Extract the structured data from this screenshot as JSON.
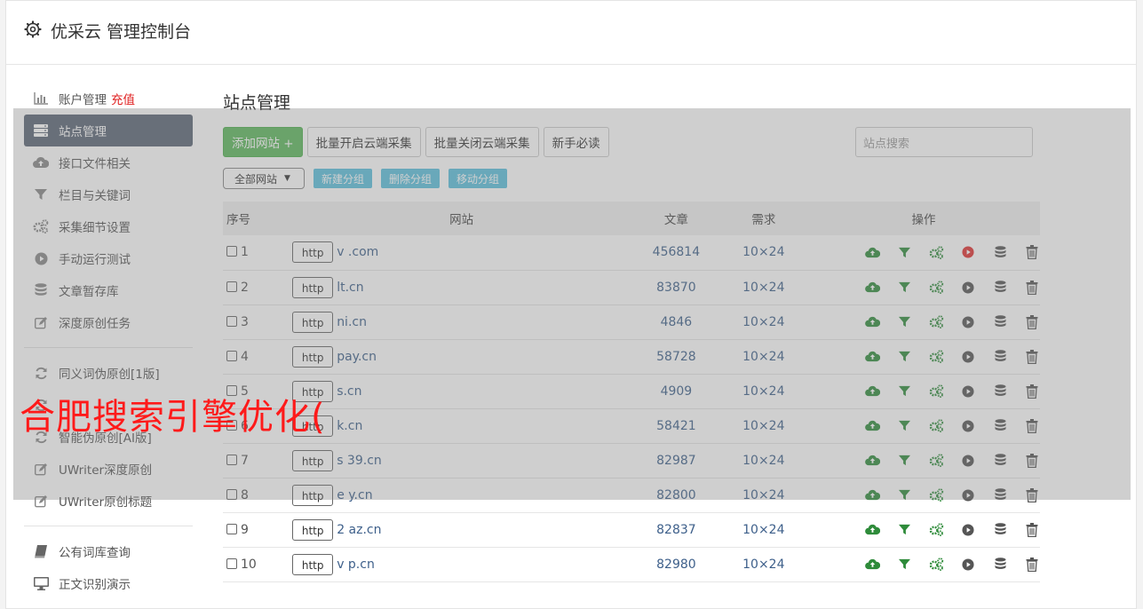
{
  "header": {
    "title": "优采云 管理控制台"
  },
  "sidebar": {
    "group1": [
      {
        "label": "账户管理",
        "extra": "充值",
        "icon": "bar-chart-icon"
      },
      {
        "label": "站点管理",
        "icon": "server-icon",
        "active": true
      },
      {
        "label": "接口文件相关",
        "icon": "cloud-upload-icon"
      },
      {
        "label": "栏目与关键词",
        "icon": "filter-icon"
      },
      {
        "label": "采集细节设置",
        "icon": "cogs-icon"
      },
      {
        "label": "手动运行测试",
        "icon": "play-circle-icon"
      },
      {
        "label": "文章暂存库",
        "icon": "database-icon"
      },
      {
        "label": "深度原创任务",
        "icon": "edit-icon"
      }
    ],
    "group2": [
      {
        "label": "同义词伪原创[1版]",
        "icon": "refresh-icon"
      },
      {
        "label": "",
        "icon": "refresh-icon"
      },
      {
        "label": "智能伪原创[AI版]",
        "icon": "refresh-icon"
      },
      {
        "label": "UWriter深度原创",
        "icon": "edit-icon"
      },
      {
        "label": "UWriter原创标题",
        "icon": "edit-icon"
      }
    ],
    "group3": [
      {
        "label": "公有词库查询",
        "icon": "book-icon"
      },
      {
        "label": "正文识别演示",
        "icon": "monitor-icon"
      }
    ]
  },
  "main": {
    "title": "站点管理",
    "toolbar": {
      "add_site": "添加网站 +",
      "batch_open": "批量开启云端采集",
      "batch_close": "批量关闭云端采集",
      "guide": "新手必读"
    },
    "search_placeholder": "站点搜索",
    "group_select": "全部网站",
    "group_buttons": {
      "new": "新建分组",
      "delete": "删除分组",
      "move": "移动分组"
    },
    "table": {
      "headers": {
        "no": "序号",
        "site": "网站",
        "articles": "文章",
        "demand": "需求",
        "ops": "操作"
      },
      "http_label": "http",
      "rows": [
        {
          "no": "1",
          "domain": "v .com",
          "articles": "456814",
          "demand": "10×24",
          "play_active": true
        },
        {
          "no": "2",
          "domain": "lt.cn",
          "articles": "83870",
          "demand": "10×24",
          "play_active": false
        },
        {
          "no": "3",
          "domain": "ni.cn",
          "articles": "4846",
          "demand": "10×24",
          "play_active": false
        },
        {
          "no": "4",
          "domain": "pay.cn",
          "articles": "58728",
          "demand": "10×24",
          "play_active": false
        },
        {
          "no": "5",
          "domain": "s.cn",
          "articles": "4909",
          "demand": "10×24",
          "play_active": false
        },
        {
          "no": "6",
          "domain": "k.cn",
          "articles": "58421",
          "demand": "10×24",
          "play_active": false
        },
        {
          "no": "7",
          "domain": "s 39.cn",
          "articles": "82987",
          "demand": "10×24",
          "play_active": false
        },
        {
          "no": "8",
          "domain": "e y.cn",
          "articles": "82800",
          "demand": "10×24",
          "play_active": false
        },
        {
          "no": "9",
          "domain": "2 az.cn",
          "articles": "82837",
          "demand": "10×24",
          "play_active": false
        },
        {
          "no": "10",
          "domain": "v p.cn",
          "articles": "82980",
          "demand": "10×24",
          "play_active": false
        }
      ]
    }
  },
  "watermark": {
    "text": "合肥搜索引擎优化("
  },
  "colors": {
    "accent_green": "#5cb85c",
    "info_blue": "#5bc0de",
    "sidebar_active": "#5a6474",
    "link_blue": "#3d5f8a",
    "icon_green": "#2e8b3a",
    "play_red": "#e03030",
    "recharge_red": "#e02020"
  }
}
